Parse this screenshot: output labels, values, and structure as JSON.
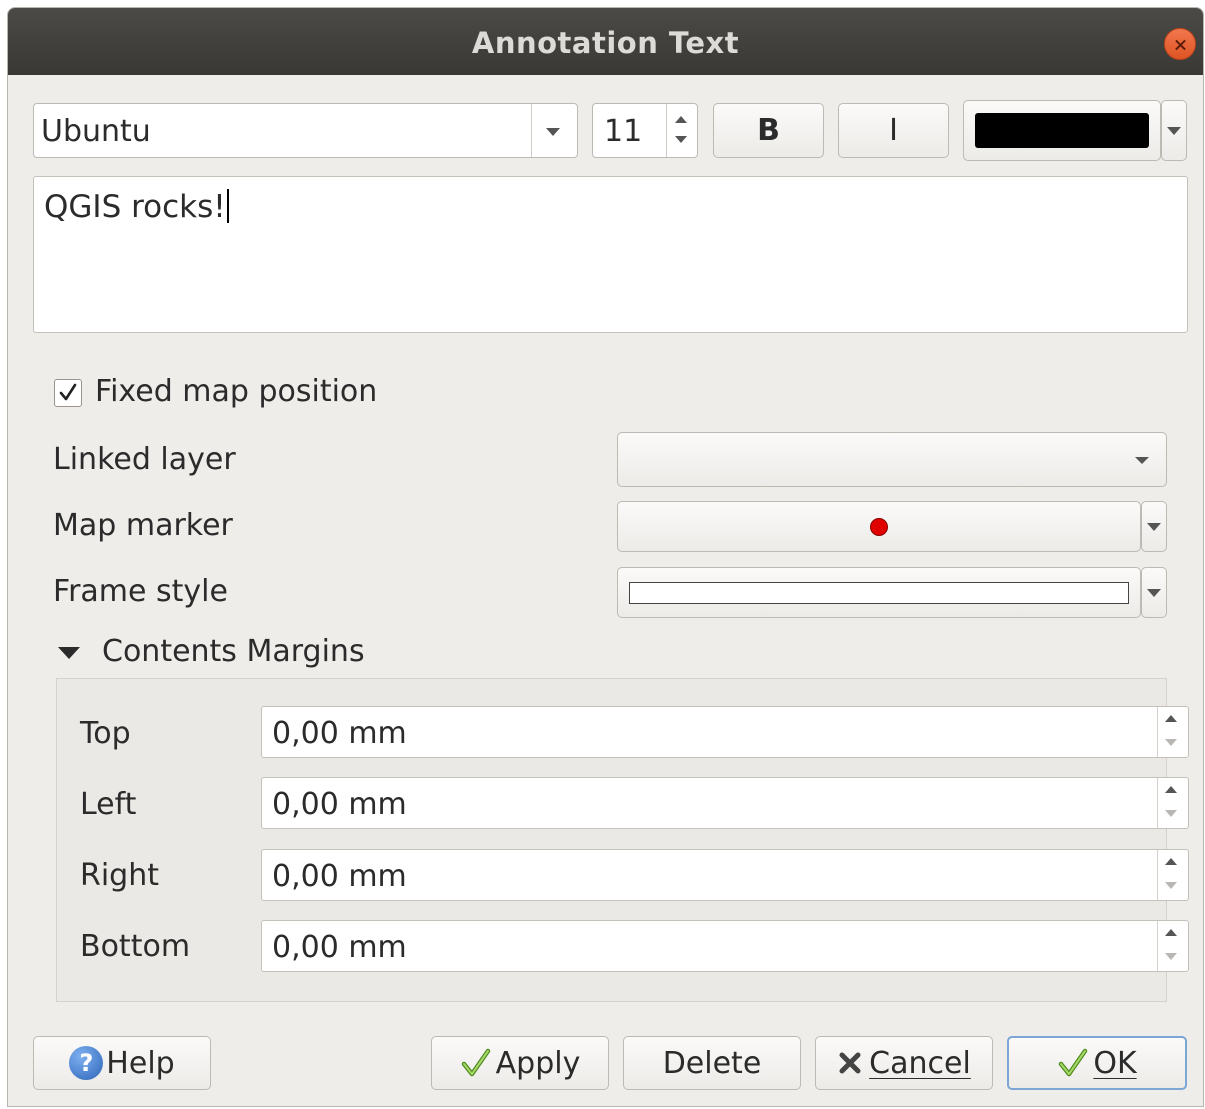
{
  "window": {
    "title": "Annotation Text"
  },
  "toolbar": {
    "font_family": "Ubuntu",
    "font_size": "11",
    "bold_label": "B",
    "italic_label": "I",
    "text_color": "#000000"
  },
  "editor": {
    "text": "QGIS rocks!"
  },
  "form": {
    "fixed_position_label": "Fixed map position",
    "fixed_position_checked": true,
    "linked_layer_label": "Linked layer",
    "linked_layer_value": "",
    "map_marker_label": "Map marker",
    "marker_color": "#e00000",
    "frame_style_label": "Frame style"
  },
  "margins": {
    "group_label": "Contents Margins",
    "rows": [
      {
        "label": "Top",
        "value": "0,00 mm"
      },
      {
        "label": "Left",
        "value": "0,00 mm"
      },
      {
        "label": "Right",
        "value": "0,00 mm"
      },
      {
        "label": "Bottom",
        "value": "0,00 mm"
      }
    ]
  },
  "buttons": {
    "help": "Help",
    "apply": "Apply",
    "delete": "Delete",
    "cancel": "Cancel",
    "ok": "OK"
  }
}
